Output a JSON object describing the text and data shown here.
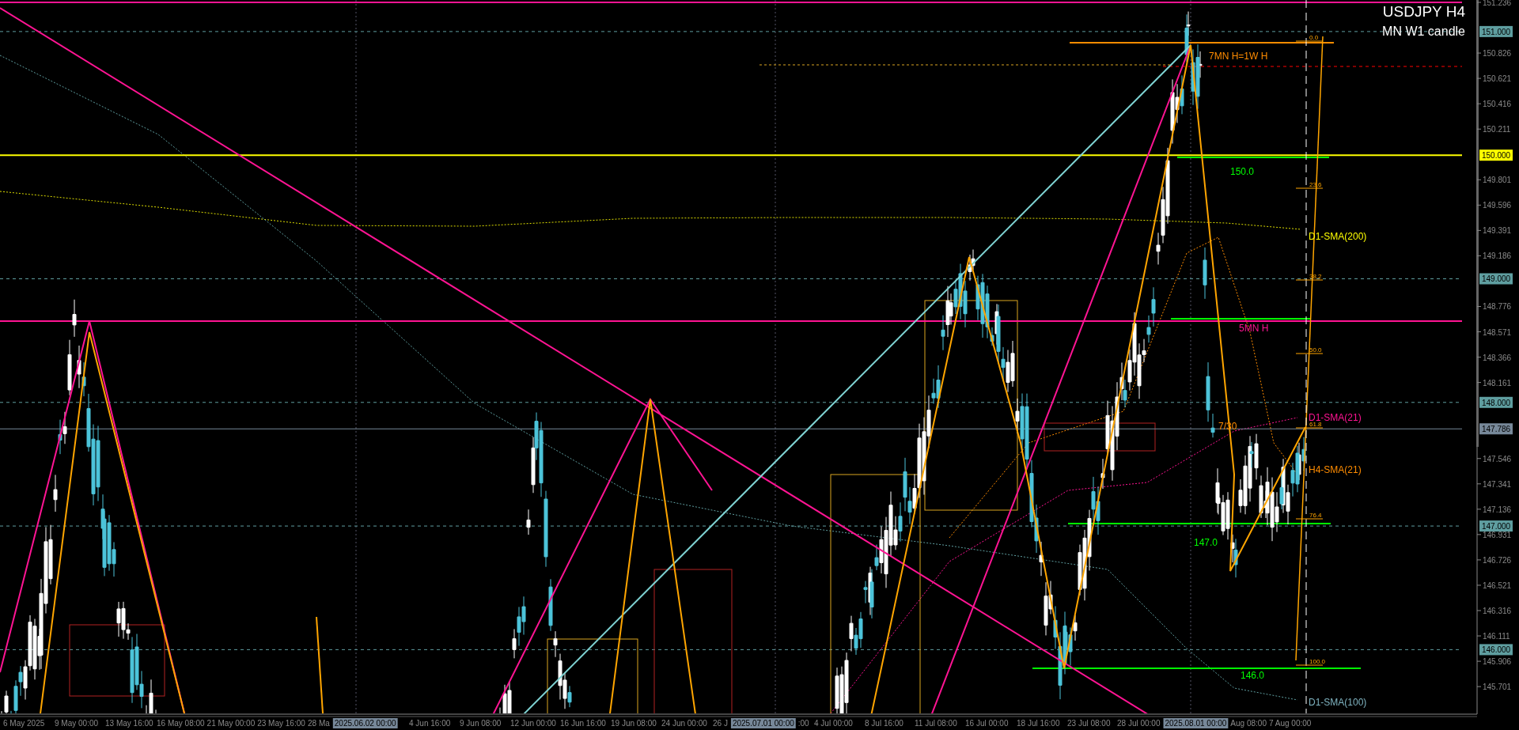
{
  "title": "USDJPY H4",
  "subtitle": "MN W1 candle",
  "price_axis": [
    {
      "text": "151.236",
      "kind": "tick"
    },
    {
      "text": "151.000",
      "kind": "tag",
      "color": "#5f9ea0"
    },
    {
      "text": "150.826",
      "kind": "tick"
    },
    {
      "text": "150.621",
      "kind": "tick"
    },
    {
      "text": "150.416",
      "kind": "tick"
    },
    {
      "text": "150.211",
      "kind": "tick"
    },
    {
      "text": "150.000",
      "kind": "tag",
      "color": "#ffff00"
    },
    {
      "text": "149.801",
      "kind": "tick"
    },
    {
      "text": "149.596",
      "kind": "tick"
    },
    {
      "text": "149.391",
      "kind": "tick"
    },
    {
      "text": "149.186",
      "kind": "tick"
    },
    {
      "text": "149.000",
      "kind": "tag",
      "color": "#5f9ea0"
    },
    {
      "text": "148.776",
      "kind": "tick"
    },
    {
      "text": "148.571",
      "kind": "tick"
    },
    {
      "text": "148.366",
      "kind": "tick"
    },
    {
      "text": "148.161",
      "kind": "tick"
    },
    {
      "text": "148.000",
      "kind": "tag",
      "color": "#5f9ea0"
    },
    {
      "text": "147.786",
      "kind": "tag",
      "color": "#778899"
    },
    {
      "text": "147.546",
      "kind": "tick"
    },
    {
      "text": "147.341",
      "kind": "tick"
    },
    {
      "text": "147.136",
      "kind": "tick"
    },
    {
      "text": "147.000",
      "kind": "tag",
      "color": "#5f9ea0"
    },
    {
      "text": "146.931",
      "kind": "tick"
    },
    {
      "text": "146.726",
      "kind": "tick"
    },
    {
      "text": "146.521",
      "kind": "tick"
    },
    {
      "text": "146.316",
      "kind": "tick"
    },
    {
      "text": "146.111",
      "kind": "tick"
    },
    {
      "text": "146.000",
      "kind": "tag",
      "color": "#5f9ea0"
    },
    {
      "text": "145.906",
      "kind": "tick"
    },
    {
      "text": "145.701",
      "kind": "tick"
    }
  ],
  "time_axis": [
    {
      "text": "6 May 2025",
      "kind": "label"
    },
    {
      "text": "9 May 00:00",
      "kind": "label"
    },
    {
      "text": "13 May 16:00",
      "kind": "label"
    },
    {
      "text": "16 May 08:00",
      "kind": "label"
    },
    {
      "text": "21 May 00:00",
      "kind": "label"
    },
    {
      "text": "23 May 16:00",
      "kind": "label"
    },
    {
      "text": "28 Ma",
      "kind": "label"
    },
    {
      "text": "2025.06.02 00:00",
      "kind": "tag"
    },
    {
      "text": "4 Jun 16:00",
      "kind": "label"
    },
    {
      "text": "9 Jun 08:00",
      "kind": "label"
    },
    {
      "text": "12 Jun 00:00",
      "kind": "label"
    },
    {
      "text": "16 Jun 16:00",
      "kind": "label"
    },
    {
      "text": "19 Jun 08:00",
      "kind": "label"
    },
    {
      "text": "24 Jun 00:00",
      "kind": "label"
    },
    {
      "text": "26 J",
      "kind": "label"
    },
    {
      "text": "2025.07.01 00:00",
      "kind": "tag"
    },
    {
      "text": ":00",
      "kind": "label"
    },
    {
      "text": "4 Jul 00:00",
      "kind": "label"
    },
    {
      "text": "8 Jul 16:00",
      "kind": "label"
    },
    {
      "text": "11 Jul 08:00",
      "kind": "label"
    },
    {
      "text": "16 Jul 00:00",
      "kind": "label"
    },
    {
      "text": "18 Jul 16:00",
      "kind": "label"
    },
    {
      "text": "23 Jul 08:00",
      "kind": "label"
    },
    {
      "text": "28 Jul 00:00",
      "kind": "label"
    },
    {
      "text": "2025.08.01 00:00",
      "kind": "tag"
    },
    {
      "text": "Aug 08:00",
      "kind": "label"
    },
    {
      "text": "7 Aug 00:00",
      "kind": "label"
    }
  ],
  "annotations": [
    {
      "text": "7MN H=1W H",
      "color": "#ff8c00"
    },
    {
      "text": "150.0",
      "color": "#00ff00"
    },
    {
      "text": "D1-SMA(200)",
      "color": "#ffff00"
    },
    {
      "text": "5MN H",
      "color": "#ff1493"
    },
    {
      "text": "D1-SMA(21)",
      "color": "#ff1493"
    },
    {
      "text": "7/30",
      "color": "#ff8c00"
    },
    {
      "text": "H4-SMA(21)",
      "color": "#ff8c00"
    },
    {
      "text": "147.0",
      "color": "#00ff00"
    },
    {
      "text": "146.0",
      "color": "#00ff00"
    },
    {
      "text": "D1-SMA(100)",
      "color": "#7fb3c0"
    }
  ],
  "fib_levels": [
    "0.0",
    "23.6",
    "38.2",
    "50.0",
    "61.8",
    "76.4",
    "100.0"
  ]
}
